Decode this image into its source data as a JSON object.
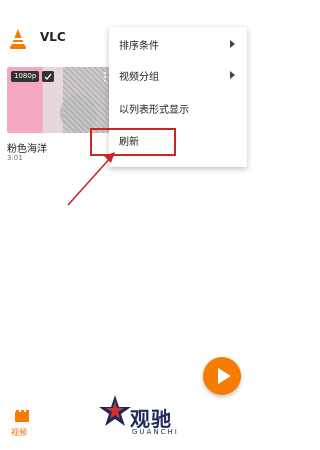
{
  "app": {
    "title": "VLC"
  },
  "video": {
    "title": "粉色海洋",
    "duration": "3:01",
    "resolution_badge": "1080p"
  },
  "menu": {
    "items": [
      {
        "label": "排序条件",
        "has_submenu": true
      },
      {
        "label": "视频分组",
        "has_submenu": true
      },
      {
        "label": "以列表形式显示",
        "has_submenu": false
      },
      {
        "label": "刷新",
        "has_submenu": false
      }
    ]
  },
  "bottom_nav": {
    "video_label": "视频"
  },
  "watermark": {
    "title": "观驰",
    "subtitle": "GUANCHI"
  },
  "colors": {
    "accent": "#f57c00",
    "highlight": "#c62828"
  }
}
